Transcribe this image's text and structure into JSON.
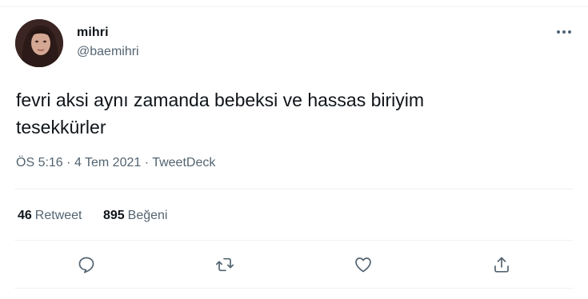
{
  "user": {
    "display_name": "mihri",
    "handle": "@baemihri"
  },
  "tweet": {
    "lines": [
      "fevri aksi aynı zamanda bebeksi ve hassas biriyim",
      "tesekkürler"
    ],
    "time": "ÖS 5:16",
    "separator": "·",
    "date": "4 Tem 2021",
    "source": "TweetDeck"
  },
  "stats": {
    "retweets_count": "46",
    "retweets_label": "Retweet",
    "likes_count": "895",
    "likes_label": "Beğeni"
  },
  "icons": {
    "more": "more-icon",
    "reply": "reply-icon",
    "retweet": "retweet-icon",
    "like": "like-icon",
    "share": "share-icon"
  },
  "colors": {
    "text": "#0f1419",
    "secondary": "#536471",
    "divider": "#eff3f4"
  }
}
